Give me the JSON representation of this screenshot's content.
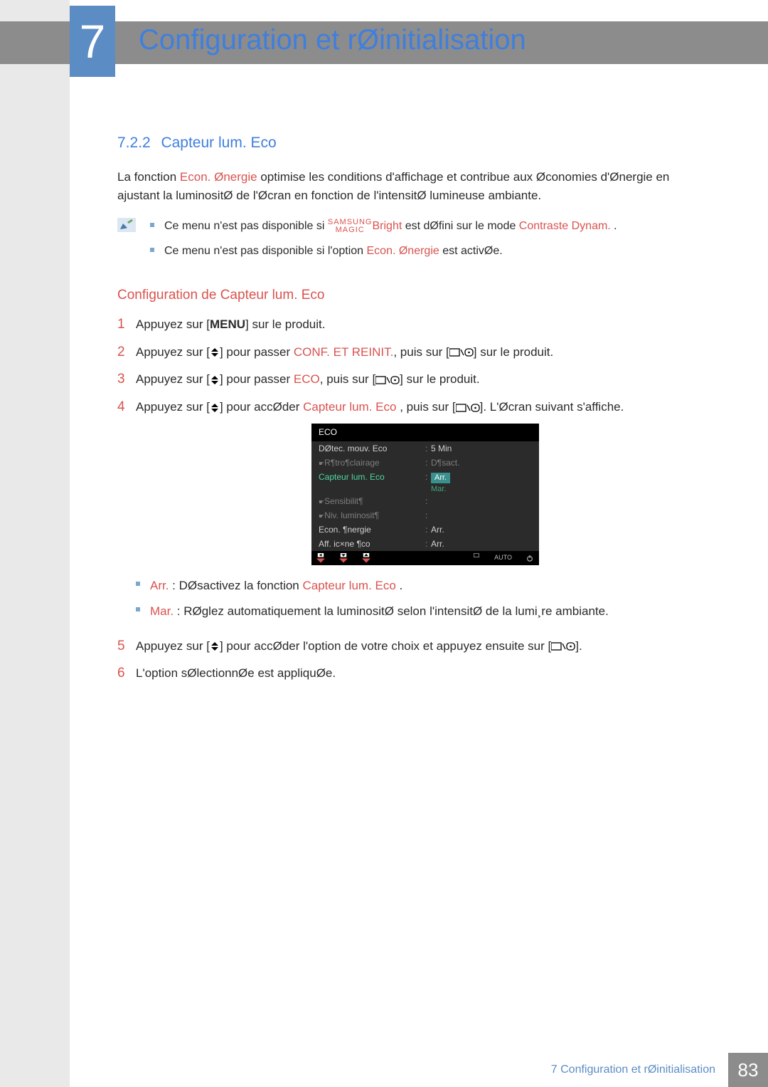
{
  "chapter": {
    "number": "7",
    "title": "Configuration et rØinitialisation"
  },
  "section": {
    "number": "7.2.2",
    "title": "Capteur lum. Eco"
  },
  "intro": {
    "pre": "La fonction ",
    "em": "Econ. Ønergie",
    "post": " optimise les conditions d'affichage et contribue aux Øconomies d'Ønergie en ajustant la luminositØ de l'Øcran en fonction de l'intensitØ lumineuse ambiante."
  },
  "notes": {
    "n1": {
      "pre": "Ce menu n'est pas disponible si ",
      "magic_top": "SAMSUNG",
      "magic_bot": "MAGIC",
      "bright": "Bright",
      "mid": " est dØfini sur le mode ",
      "dynam": "Contraste Dynam.",
      "tail": " ."
    },
    "n2": {
      "pre": "Ce menu n'est pas disponible si l'option ",
      "em": "Econ. Ønergie",
      "post": " est activØe."
    }
  },
  "subheading": "Configuration de Capteur lum. Eco",
  "steps": {
    "s1": {
      "pre": "Appuyez sur [",
      "menu": "MENU",
      "post": "] sur le produit."
    },
    "s2": {
      "pre": "Appuyez sur [",
      "mid1": "] pour passer   ",
      "em": "CONF. ET REINIT.",
      "mid2": ", puis sur [",
      "post": "] sur le produit."
    },
    "s3": {
      "pre": "Appuyez sur [",
      "mid1": "] pour passer   ",
      "em": "ECO",
      "mid2": ", puis sur [",
      "post": "] sur le produit."
    },
    "s4": {
      "pre": "Appuyez sur [",
      "mid1": "] pour accØder   ",
      "em": "Capteur lum. Eco",
      "mid2": " , puis sur [",
      "mid3": "]. L'Øcran suivant s'affiche."
    },
    "s5": {
      "pre": "Appuyez sur [",
      "mid1": "] pour accØder   l'option de votre choix et appuyez ensuite sur [",
      "post": "]."
    },
    "s6": {
      "text": "L'option sØlectionnØe est appliquØe."
    }
  },
  "osd": {
    "title": "ECO",
    "rows": {
      "r1": {
        "label": "DØtec. mouv. Eco",
        "val": "5 Min"
      },
      "r2": {
        "label": "R¶tro¶clairage",
        "val": "D¶sact."
      },
      "r3": {
        "label": "Capteur lum. Eco",
        "sel": "Arr.",
        "opt": "Mar."
      },
      "r4": {
        "label": "Sensibilit¶",
        "val": ""
      },
      "r5": {
        "label": "Niv. luminosit¶",
        "val": ""
      },
      "r6": {
        "label": "Econ. ¶nergie",
        "val": "Arr."
      },
      "r7": {
        "label": "Aff. ic×ne ¶co",
        "val": "Arr."
      }
    },
    "footer": {
      "auto": "AUTO"
    }
  },
  "options": {
    "arr": {
      "em": "Arr.",
      "txt": " : DØsactivez la fonction ",
      "em2": "Capteur lum. Eco",
      "tail": " ."
    },
    "mar": {
      "em": "Mar.",
      "txt": " : RØglez automatiquement la luminositØ selon l'intensitØ de la lumi¸re ambiante."
    }
  },
  "footer": {
    "text": "7 Configuration et  rØinitialisation",
    "page": "83"
  }
}
